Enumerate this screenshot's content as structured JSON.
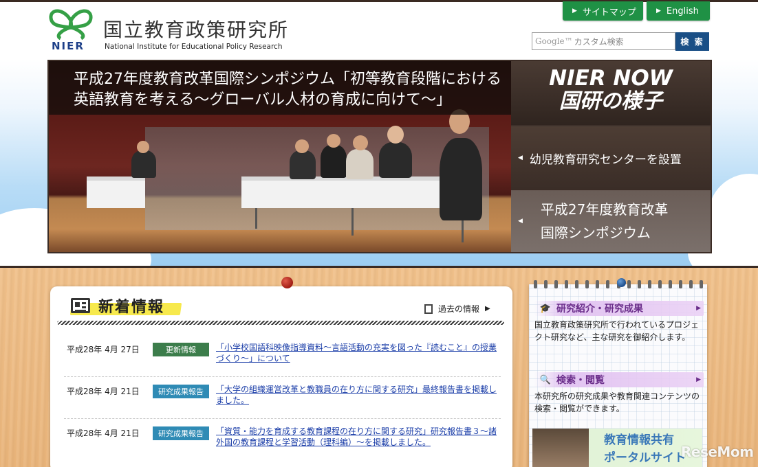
{
  "header": {
    "logo_mark": "NIER",
    "site_title": "国立教育政策研究所",
    "site_subtitle": "National Institute for Educational Policy Research",
    "buttons": [
      {
        "label": "サイトマップ"
      },
      {
        "label": "English"
      }
    ],
    "search": {
      "placeholder": "カスタム検索",
      "google_mark": "Google™",
      "button_label": "検 索"
    }
  },
  "banner": {
    "caption_line1": "平成27年度教育改革国際シンポジウム「初等教育段階における",
    "caption_line2": "英語教育を考える～グローバル人材の育成に向けて～」",
    "panel_title_1": "NIER NOW",
    "panel_title_2": "国研の様子",
    "items": [
      {
        "label": "幼児教育研究センターを設置"
      },
      {
        "label_line1": "平成27年度教育改革",
        "label_line2": "国際シンポジウム"
      }
    ]
  },
  "news": {
    "title": "新着情報",
    "past_link": "過去の情報",
    "rows": [
      {
        "date": "平成28年 4月 27日",
        "tag": "更新情報",
        "tag_color": "#3c7d4b",
        "link": "「小学校国語科映像指導資料～言語活動の充実を図った『読むこと』の授業づくり～」について"
      },
      {
        "date": "平成28年 4月 21日",
        "tag": "研究成果報告",
        "tag_color": "#2f8bb5",
        "link": "「大学の組織運営改革と教職員の在り方に関する研究」最終報告書を掲載しました。"
      },
      {
        "date": "平成28年 4月 21日",
        "tag": "研究成果報告",
        "tag_color": "#2f8bb5",
        "link": "「資質・能力を育成する教育課程の在り方に関する研究」研究報告書３～諸外国の教育課程と学習活動（理科編）～を掲載しました。"
      }
    ]
  },
  "sidebar": {
    "sections": [
      {
        "heading": "研究紹介・研究成果",
        "icon": "graduation-cap-icon",
        "text": "国立教育政策研究所で行われているプロジェクト研究など、主な研究を御紹介します。"
      },
      {
        "heading": "検索・閲覧",
        "icon": "magnifier-icon",
        "text": "本研究所の研究成果や教育関連コンテンツの検索・閲覧ができます。"
      }
    ],
    "portal_line1": "教育情報共有",
    "portal_line2": "ポータルサイト"
  },
  "watermark": "ReseMom",
  "colors": {
    "green_button": "#1f9145",
    "search_button": "#1a4f86",
    "link": "#1a3da8",
    "heading_purple": "#6a2d8a"
  }
}
